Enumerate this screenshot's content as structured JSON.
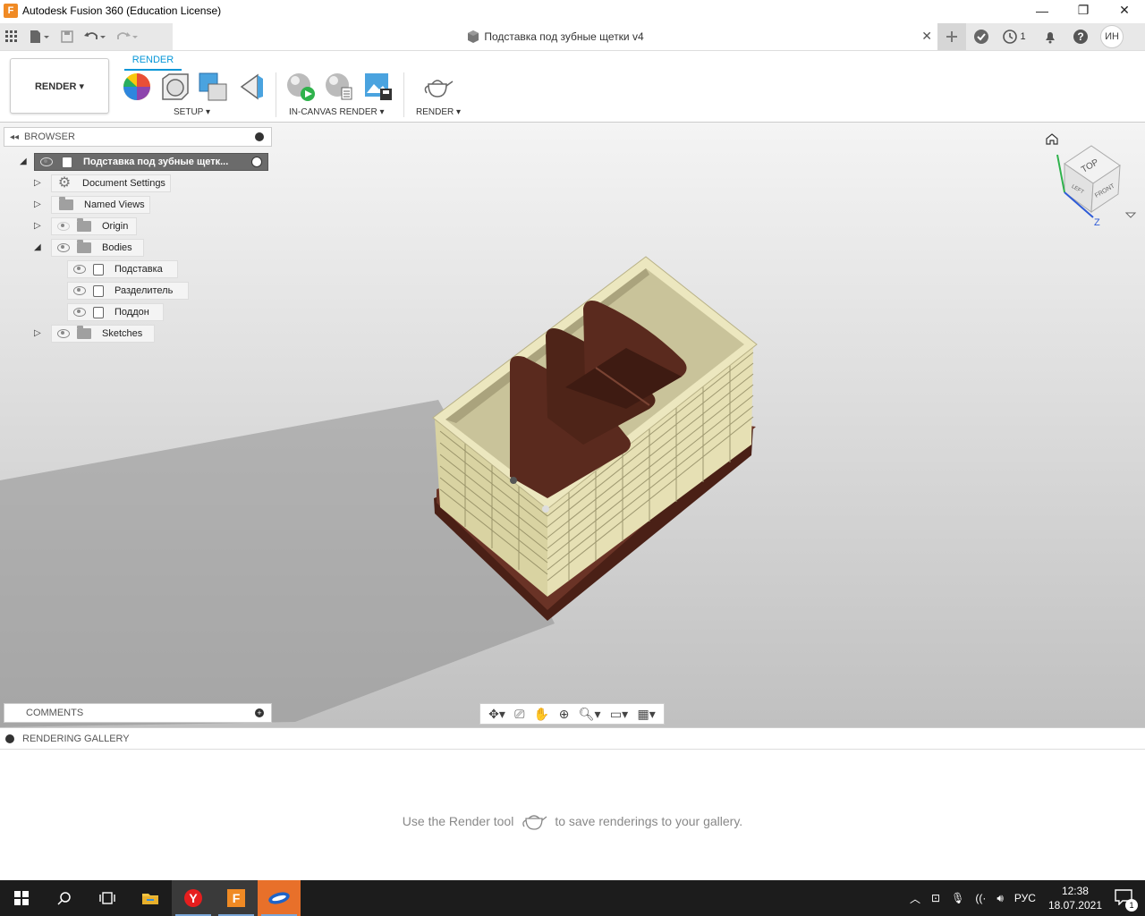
{
  "window": {
    "app_title": "Autodesk Fusion 360 (Education License)",
    "minimize": "—",
    "restore": "❐",
    "close": "✕"
  },
  "document": {
    "title": "Подставка под зубные щетки v4",
    "close_label": "✕"
  },
  "qat_right": {
    "job_count": "1",
    "user_initials": "ИН"
  },
  "ribbon": {
    "workspace": "RENDER ▾",
    "active_tab": "RENDER",
    "groups": {
      "setup": "SETUP ▾",
      "in_canvas": "IN-CANVAS RENDER ▾",
      "render": "RENDER ▾"
    }
  },
  "browser": {
    "title": "BROWSER",
    "root": "Подставка под зубные щетк...",
    "items": {
      "document_settings": "Document Settings",
      "named_views": "Named Views",
      "origin": "Origin",
      "bodies": "Bodies",
      "body1": "Подставка",
      "body2": "Разделитель",
      "body3": "Поддон",
      "sketches": "Sketches"
    }
  },
  "comments": {
    "title": "COMMENTS"
  },
  "viewcube": {
    "top": "TOP",
    "front": "FRONT",
    "left": "LEFT",
    "axis_z": "Z"
  },
  "gallery": {
    "title": "RENDERING GALLERY",
    "message_before": "Use the Render tool",
    "message_after": "to save renderings to your gallery."
  },
  "taskbar": {
    "language": "РУС",
    "time": "12:38",
    "date": "18.07.2021",
    "notifications": "1"
  },
  "colors": {
    "accent": "#0696d7",
    "model_body": "#e6e0b4",
    "model_wood": "#5a2a1e",
    "taskbar": "#1c1c1c"
  }
}
